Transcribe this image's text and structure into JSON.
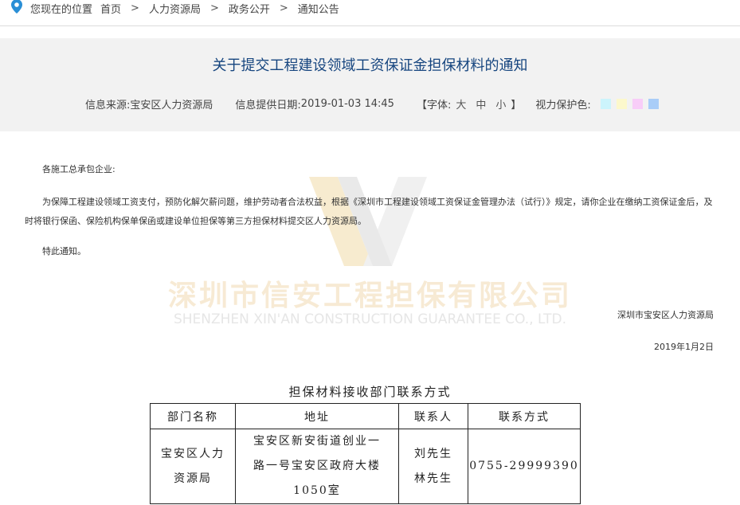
{
  "breadcrumb": {
    "label": "您现在的位置",
    "items": [
      "首页",
      "人力资源局",
      "政务公开",
      "通知公告"
    ],
    "separator": ">"
  },
  "article": {
    "title": "关于提交工程建设领域工资保证金担保材料的通知",
    "source_label": "信息来源:",
    "source": "宝安区人力资源局",
    "date_label": "信息提供日期:",
    "date": "2019-01-03 14:45",
    "font_open": "【字体:",
    "font_sizes": [
      "大",
      "中",
      "小"
    ],
    "font_close": "】",
    "eye_label": "视力保护色:",
    "eye_colors": [
      "#ccf4fc",
      "#fcf8cc",
      "#f8cdf8",
      "#a9cdf8"
    ]
  },
  "content": {
    "greeting": "各施工总承包企业:",
    "body": "为保障工程建设领域工资支付，预防化解欠薪问题，维护劳动者合法权益，根据《深圳市工程建设领域工资保证金管理办法（试行）》规定，请你企业在缴纳工资保证金后，及时将银行保函、保险机构保单保函或建设单位担保等第三方担保材料提交区人力资源局。",
    "closing": "特此通知。",
    "signature": "深圳市宝安区人力资源局",
    "sign_date": "2019年1月2日"
  },
  "watermark": {
    "cn": "深圳市信安工程担保有限公司",
    "en": "SHENZHEN XIN'AN CONSTRUCTION GUARANTEE CO., LTD."
  },
  "contact_table": {
    "caption": "担保材料接收部门联系方式",
    "headers": [
      "部门名称",
      "地址",
      "联系人",
      "联系方式"
    ],
    "row": {
      "dept": [
        "宝安区人力",
        "资源局"
      ],
      "address": [
        "宝安区新安街道创业一",
        "路一号宝安区政府大楼",
        "1050室"
      ],
      "contacts": [
        "刘先生",
        "林先生"
      ],
      "phone": "0755-29999390"
    }
  },
  "colors": {
    "title": "#16457f",
    "header_bg": "#f2f2f2",
    "pin": "#2a8fd6"
  }
}
